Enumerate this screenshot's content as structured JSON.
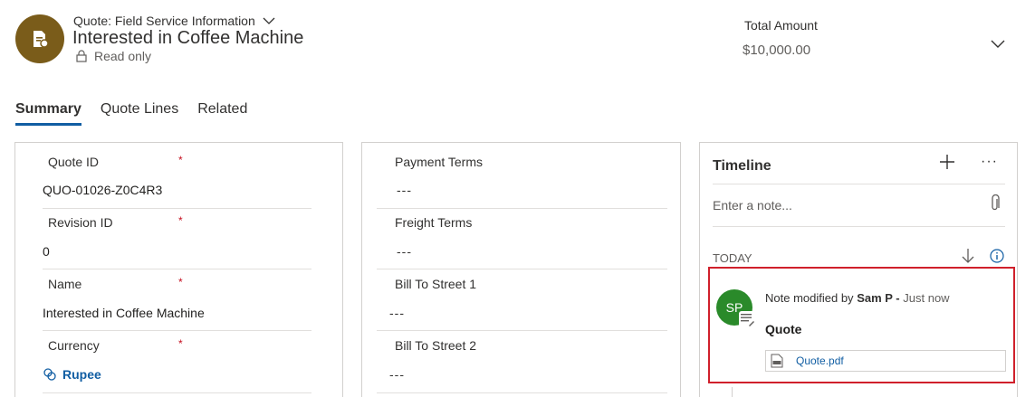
{
  "header": {
    "entity_type": "Quote: Field Service Information",
    "title": "Interested in Coffee Machine",
    "readonly_label": "Read only",
    "total_label": "Total Amount",
    "total_value": "$10,000.00"
  },
  "tabs": [
    {
      "label": "Summary",
      "active": true
    },
    {
      "label": "Quote Lines",
      "active": false
    },
    {
      "label": "Related",
      "active": false
    }
  ],
  "summary": {
    "quote_id_label": "Quote ID",
    "quote_id_value": "QUO-01026-Z0C4R3",
    "revision_label": "Revision ID",
    "revision_value": "0",
    "name_label": "Name",
    "name_value": "Interested in Coffee Machine",
    "currency_label": "Currency",
    "currency_value": "Rupee",
    "required_marker": "*"
  },
  "terms": {
    "payment_label": "Payment Terms",
    "payment_value": "---",
    "freight_label": "Freight Terms",
    "freight_value": "---",
    "street1_label": "Bill To Street 1",
    "street1_value": "---",
    "street2_label": "Bill To Street 2",
    "street2_value": "---"
  },
  "timeline": {
    "title": "Timeline",
    "more": "···",
    "note_placeholder": "Enter a note...",
    "group_label": "TODAY",
    "note": {
      "avatar_initials": "SP",
      "prefix": "Note modified by",
      "author": "Sam P -",
      "time": "Just now",
      "title": "Quote",
      "attachment": "Quote.pdf"
    }
  },
  "colors": {
    "entity_avatar": "#7a5c1a",
    "user_avatar": "#2a8a2a",
    "accent": "#115ea3",
    "required": "#c50f1f",
    "highlight_border": "#d0202b"
  }
}
